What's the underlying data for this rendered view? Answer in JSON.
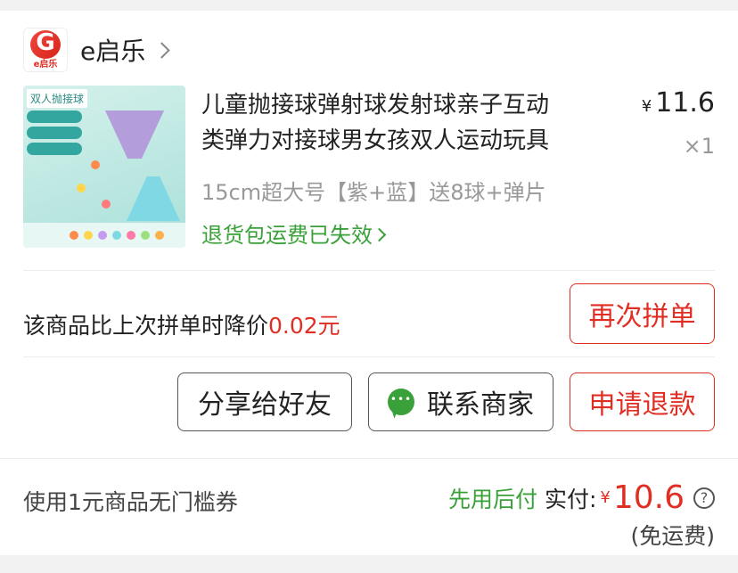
{
  "shop": {
    "logo_text": "e启乐",
    "name": "e启乐"
  },
  "product": {
    "title_line1": "儿童抛接球弹射球发射球亲子互动",
    "title_line2": "类弹力对接球男女孩双人运动玩具",
    "price_symbol": "¥",
    "price": "11.6",
    "quantity": "×1",
    "spec": "15cm超大号【紫+蓝】送8球+弹片",
    "refund_status": "退货包运费已失效",
    "thumb_tag": "双人抛接球"
  },
  "price_drop": {
    "text": "该商品比上次拼单时降价",
    "amount": "0.02元"
  },
  "buttons": {
    "reorder": "再次拼单",
    "share": "分享给好友",
    "contact": "联系商家",
    "refund": "申请退款"
  },
  "footer": {
    "coupon": "使用1元商品无门槛券",
    "pay_later": "先用后付",
    "paid_label": "实付:",
    "currency": "¥",
    "total": "10.6",
    "shipping": "(免运费)"
  },
  "icons": [
    "chevron-right-icon",
    "chat-icon",
    "help-icon"
  ],
  "colors": {
    "accent_red": "#e02e24",
    "green": "#3aa13a",
    "gray_text": "#999999"
  }
}
